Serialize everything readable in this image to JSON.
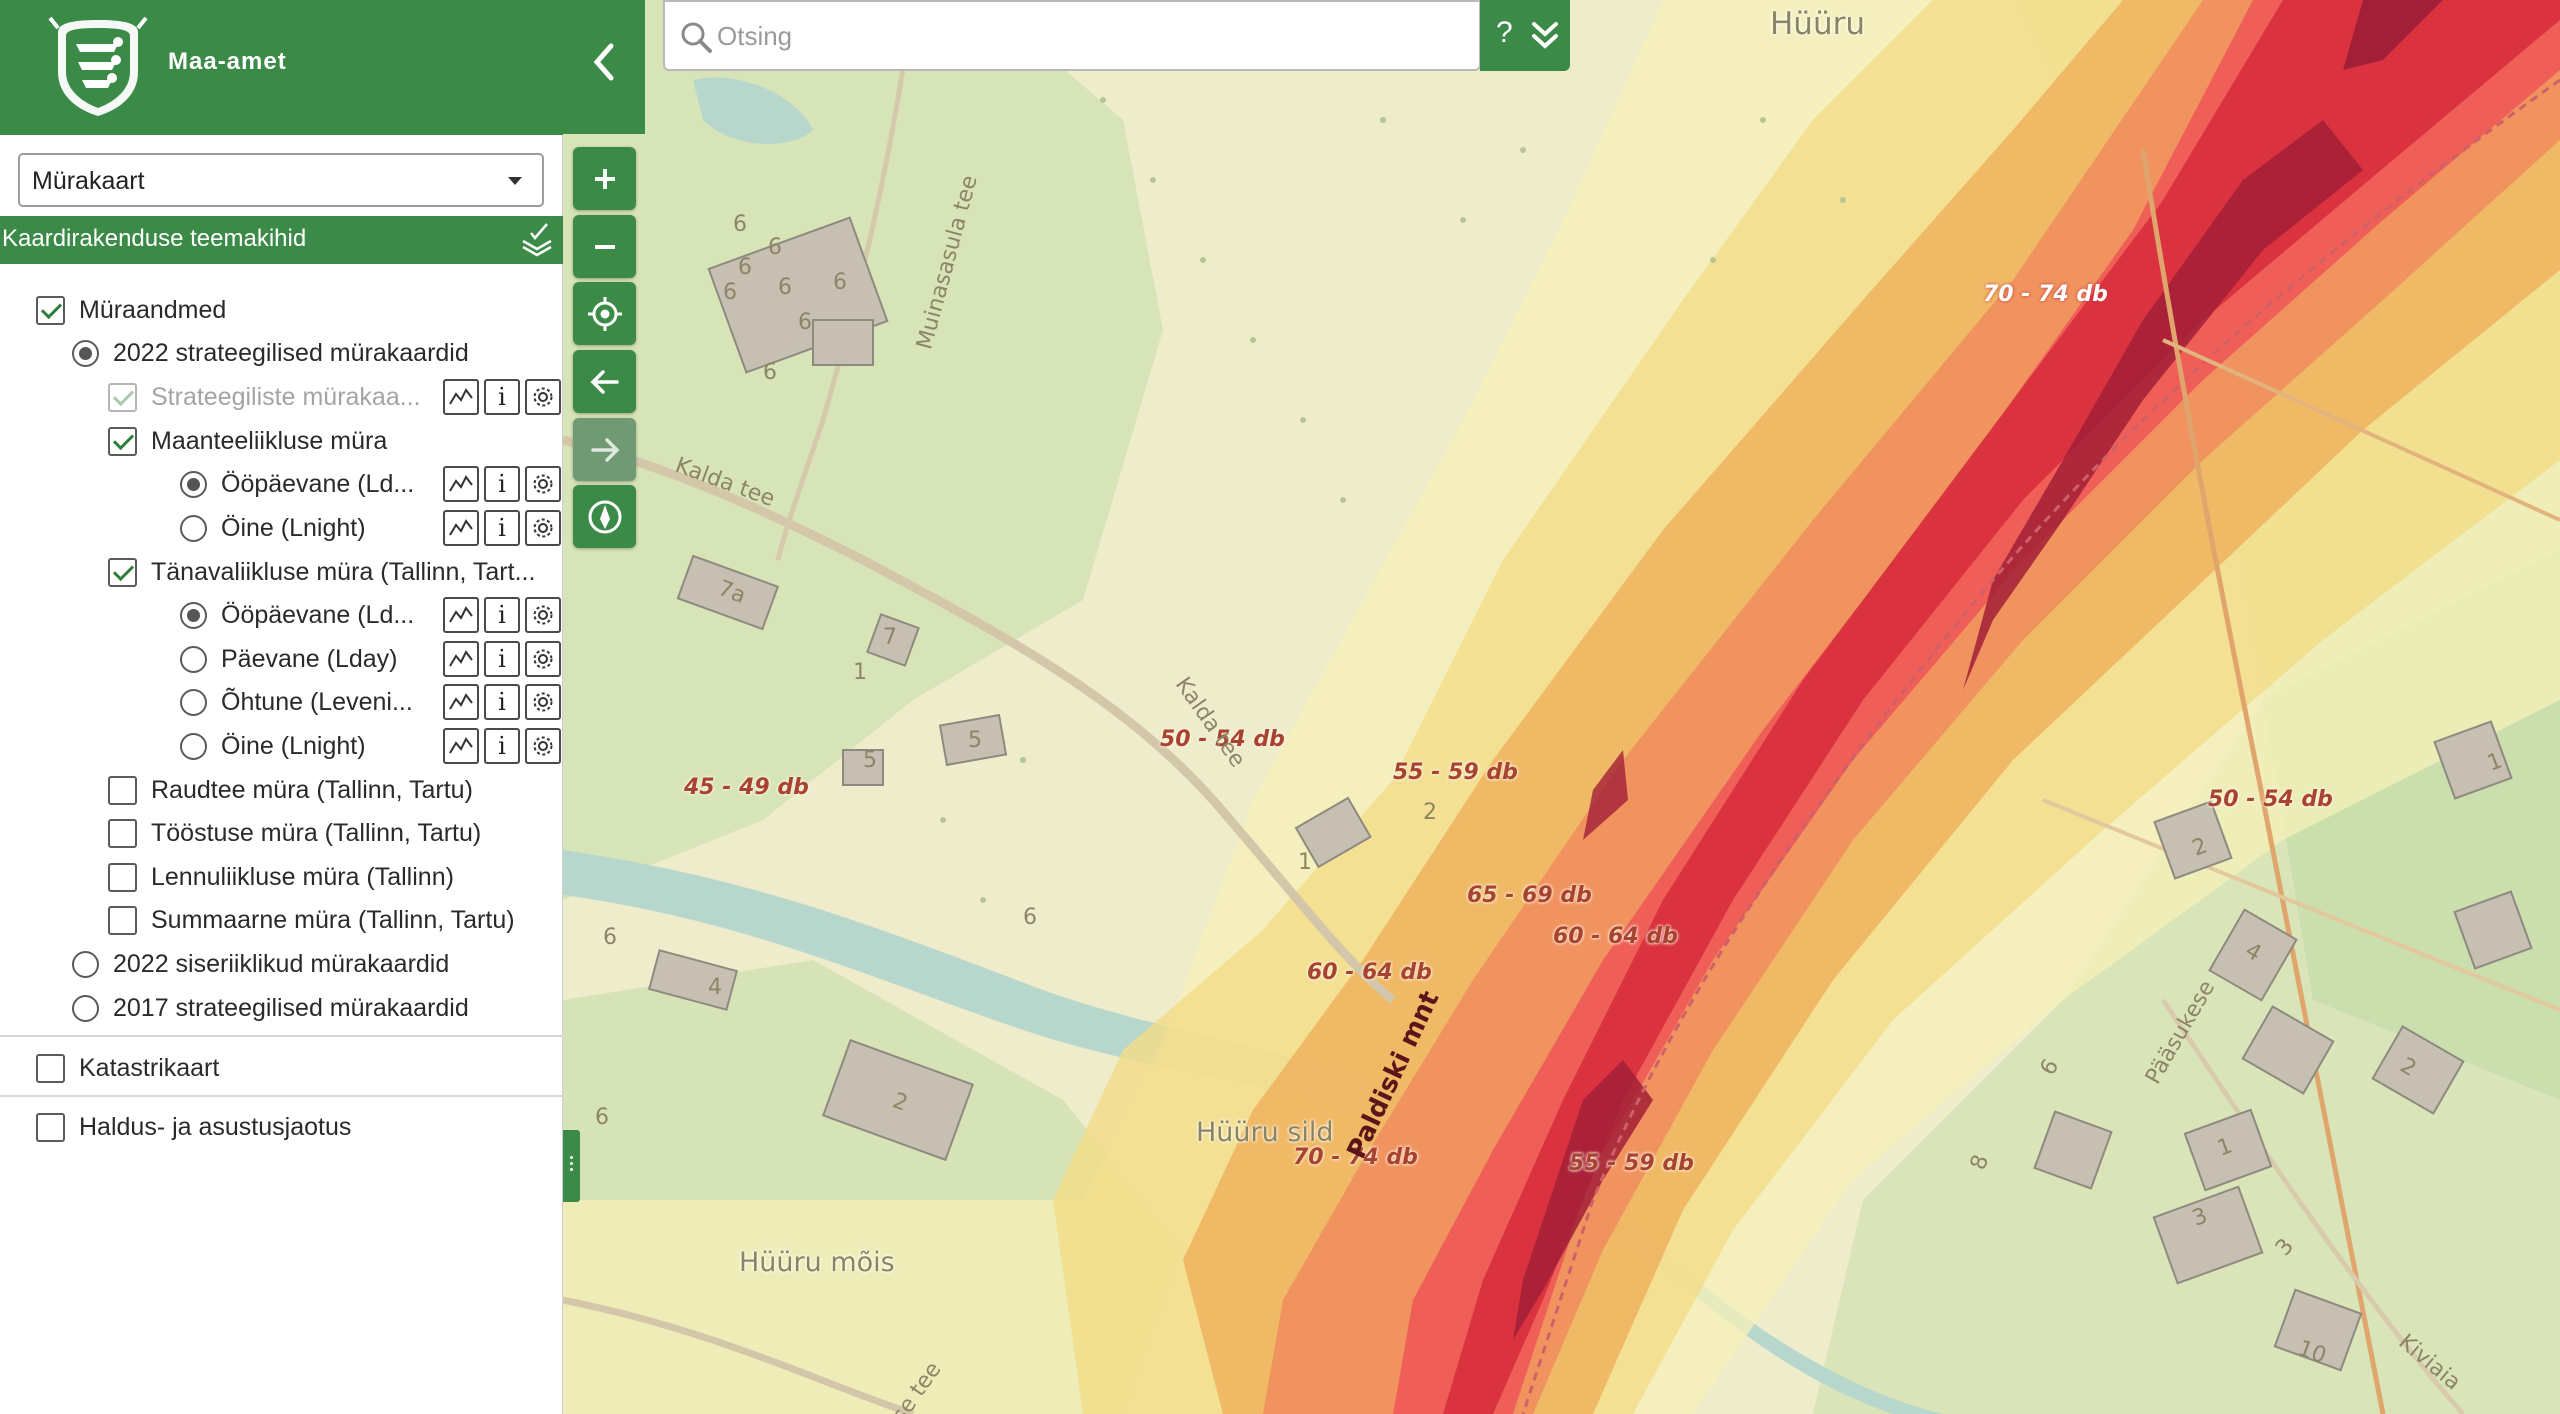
{
  "header": {
    "brand": "Maa-amet"
  },
  "theme_select": {
    "value": "Mürakaart"
  },
  "layers_bar": {
    "title": "Kaardirakenduse teemakihid"
  },
  "tree": [
    {
      "label": "Müraandmed"
    },
    {
      "label": "2022 strateegilised mürakaardid"
    },
    {
      "label": "Strateegiliste mürakaa..."
    },
    {
      "label": "Maanteeliikluse müra"
    },
    {
      "label": "Ööpäevane (Ld..."
    },
    {
      "label": "Öine (Lnight)"
    },
    {
      "label": "Tänavaliikluse müra (Tallinn, Tart..."
    },
    {
      "label": "Ööpäevane (Ld..."
    },
    {
      "label": "Päevane (Lday)"
    },
    {
      "label": "Õhtune (Leveni..."
    },
    {
      "label": "Öine (Lnight)"
    },
    {
      "label": "Raudtee müra (Tallinn, Tartu)"
    },
    {
      "label": "Tööstuse müra (Tallinn, Tartu)"
    },
    {
      "label": "Lennuliikluse müra (Tallinn)"
    },
    {
      "label": "Summaarne müra (Tallinn, Tartu)"
    },
    {
      "label": "2022 siseriiklikud mürakaardid"
    },
    {
      "label": "2017 strateegilised mürakaardid"
    },
    {
      "label": "Katastrikaart"
    },
    {
      "label": "Haldus- ja asustusjaotus"
    }
  ],
  "tool_info_glyph": "i",
  "search": {
    "placeholder": "Otsing",
    "help": "?"
  },
  "map": {
    "noise_labels": [
      "70 - 74 db",
      "50 - 54 db",
      "45 - 49 db",
      "55 - 59 db",
      "65 - 69 db",
      "60 - 64 db",
      "60 - 64 db",
      "50 - 54 db",
      "70 - 74 db",
      "55 - 59 db"
    ],
    "places": {
      "huuru": "Hüüru",
      "huuru_sild": "Hüüru sild",
      "huuru_mois": "Hüüru mõis"
    },
    "roads": {
      "kalda_tee_1": "Kalda tee",
      "kalda_tee_2": "Kalda tee",
      "muinasasula": "Muinasasula tee",
      "paldiski": "Paldiski mnt",
      "paasukese": "Pääsukese",
      "kiviaia": "Kiviaia",
      "se_tee": "se tee"
    },
    "house_numbers": [
      "6",
      "6",
      "6",
      "6",
      "6",
      "6",
      "6",
      "6",
      "7a",
      "7",
      "1",
      "5",
      "5",
      "2",
      "1",
      "4",
      "2",
      "6",
      "8",
      "3",
      "3",
      "10",
      "2",
      "4",
      "2",
      "1",
      "6",
      "1",
      "6",
      "6"
    ]
  },
  "colors": {
    "brand_green": "#3c8a47",
    "noise_45_49": "#f6f0b8",
    "noise_50_54": "#f2dc87",
    "noise_55_59": "#efb25e",
    "noise_60_64": "#f08c5e",
    "noise_65_69": "#ee5a58",
    "noise_70_74": "#d8303e",
    "noise_75": "#a21f37"
  }
}
